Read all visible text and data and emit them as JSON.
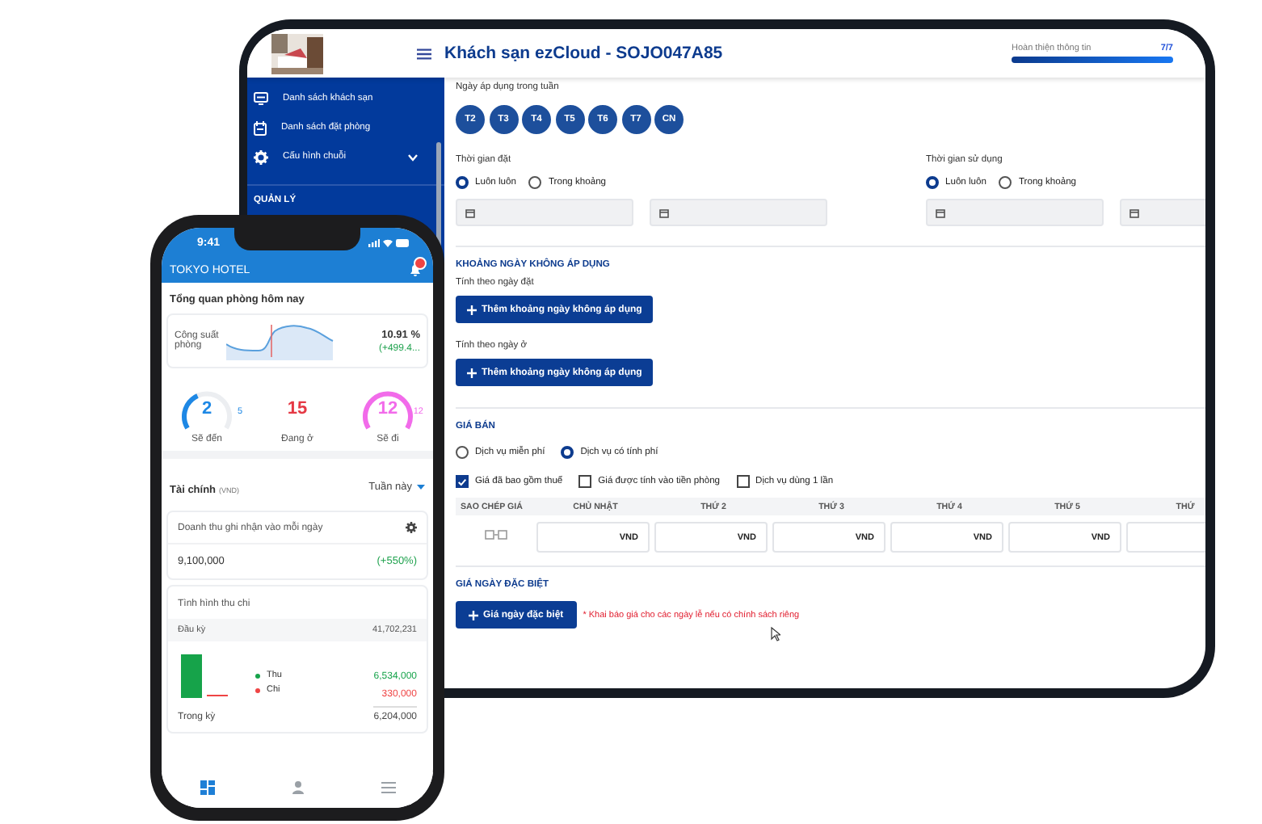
{
  "tablet": {
    "header": {
      "title": "Khách sạn ezCloud - SOJO047A85",
      "progress_label": "Hoàn thiện thông tin",
      "progress_value": "7/7",
      "level": 1
    },
    "sidebar": {
      "items": [
        {
          "label": "Danh sách khách sạn",
          "kind": "link"
        },
        {
          "label": "Danh sách đặt phòng",
          "kind": "link"
        },
        {
          "label": "Cấu hình chuỗi",
          "kind": "group",
          "expanded": false
        }
      ],
      "section": "QUẢN LÝ"
    },
    "weekdays": {
      "label": "Ngày áp dụng trong tuần",
      "days": [
        {
          "label": "T2",
          "selected": true
        },
        {
          "label": "T3",
          "selected": true
        },
        {
          "label": "T4",
          "selected": true
        },
        {
          "label": "T5",
          "selected": true
        },
        {
          "label": "T6",
          "selected": true
        },
        {
          "label": "T7",
          "selected": true
        },
        {
          "label": "CN",
          "selected": true
        }
      ]
    },
    "time_groups": [
      {
        "label": "Thời gian đặt",
        "options": [
          {
            "label": "Luôn luôn",
            "selected": true
          },
          {
            "label": "Trong khoảng",
            "selected": false
          }
        ]
      },
      {
        "label": "Thời gian sử dụng",
        "options": [
          {
            "label": "Luôn luôn",
            "selected": true
          },
          {
            "label": "Trong khoảng",
            "selected": false
          }
        ]
      }
    ],
    "excluded_ranges": {
      "title": "KHOẢNG NGÀY KHÔNG ÁP DỤNG",
      "groups": [
        {
          "label": "Tính theo ngày đặt",
          "button": "Thêm khoảng ngày không áp dụng"
        },
        {
          "label": "Tính theo ngày ở",
          "button": "Thêm khoảng ngày không áp dụng"
        }
      ]
    },
    "selling_price": {
      "title": "GIÁ BÁN",
      "service_options": [
        {
          "label": "Dịch vụ miễn phí",
          "selected": false
        },
        {
          "label": "Dịch vụ có tính phí",
          "selected": true
        }
      ],
      "flags": [
        {
          "label": "Giá đã bao gồm thuế",
          "checked": true
        },
        {
          "label": "Giá được tính vào tiền phòng",
          "checked": false
        },
        {
          "label": "Dịch vụ dùng 1 lần",
          "checked": false
        }
      ],
      "copy_column": "SAO CHÉP GIÁ",
      "price_columns": [
        {
          "label": "CHỦ NHẬT",
          "unit": "VND"
        },
        {
          "label": "THỨ 2",
          "unit": "VND"
        },
        {
          "label": "THỨ 3",
          "unit": "VND"
        },
        {
          "label": "THỨ 4",
          "unit": "VND"
        },
        {
          "label": "THỨ 5",
          "unit": "VND"
        },
        {
          "label": "THỨ"
        }
      ]
    },
    "special_price": {
      "title": "GIÁ NGÀY ĐẶC BIỆT",
      "button": "Giá ngày đặc biệt",
      "note": "* Khai báo giá cho các ngày lễ nếu có chính sách riêng"
    }
  },
  "phone": {
    "status_time": "9:41",
    "hotel": "TOKYO HOTEL",
    "overview_title": "Tổng quan phòng hôm nay",
    "occupancy": {
      "label": "Công suất phòng",
      "value": "10.91 %",
      "change": "(+499.4..."
    },
    "room_stats": [
      {
        "kind": "gauge",
        "value": "2",
        "total": "5",
        "label": "Sẽ đến",
        "color": "#1e88e5"
      },
      {
        "kind": "plain",
        "value": "15",
        "label": "Đang ở",
        "color": "#e53945"
      },
      {
        "kind": "gauge",
        "value": "12",
        "total": "12",
        "label": "Sẽ đi",
        "color": "#f26bea"
      }
    ],
    "finance": {
      "title": "Tài chính",
      "unit": "(VND)",
      "period": "Tuần này",
      "daily_revenue": {
        "label": "Doanh thu ghi nhận vào mỗi ngày",
        "value": "9,100,000",
        "change": "(+550%)"
      },
      "cashflow": {
        "title": "Tình hình thu chi",
        "opening_label": "Đầu kỳ",
        "opening_value": "41,702,231",
        "legend": [
          {
            "label": "Thu",
            "color": "#16a34a"
          },
          {
            "label": "Chi",
            "color": "#ef4444"
          }
        ],
        "income": "6,534,000",
        "expense": "330,000",
        "period_label": "Trong kỳ",
        "net": "6,204,000"
      }
    },
    "nav": [
      {
        "selected": true
      },
      {
        "selected": false
      },
      {
        "selected": false
      }
    ]
  }
}
